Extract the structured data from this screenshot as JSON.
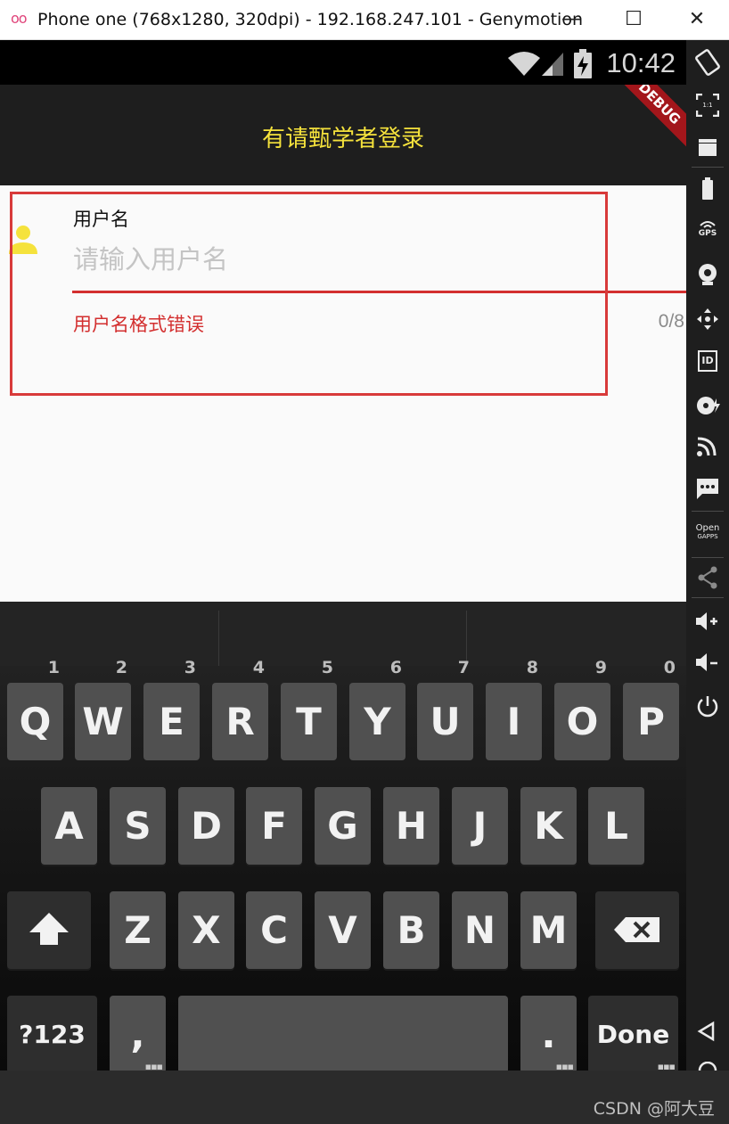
{
  "window": {
    "logo": "oo",
    "title": "Phone one (768x1280, 320dpi) - 192.168.247.101 - Genymotion",
    "minimize": "—",
    "maximize": "☐",
    "close": "✕"
  },
  "statusbar": {
    "time": "10:42"
  },
  "appbar": {
    "title": "有请甄学者登录",
    "banner": "DEBUG"
  },
  "form": {
    "label": "用户名",
    "placeholder": "请输入用户名",
    "error": "用户名格式错误",
    "counter": "0/8",
    "colors": {
      "error": "#d32f2f",
      "icon": "#f5e23c"
    }
  },
  "keyboard": {
    "row1": [
      {
        "key": "Q",
        "num": "1"
      },
      {
        "key": "W",
        "num": "2"
      },
      {
        "key": "E",
        "num": "3"
      },
      {
        "key": "R",
        "num": "4"
      },
      {
        "key": "T",
        "num": "5"
      },
      {
        "key": "Y",
        "num": "6"
      },
      {
        "key": "U",
        "num": "7"
      },
      {
        "key": "I",
        "num": "8"
      },
      {
        "key": "O",
        "num": "9"
      },
      {
        "key": "P",
        "num": "0"
      }
    ],
    "row2": [
      "A",
      "S",
      "D",
      "F",
      "G",
      "H",
      "J",
      "K",
      "L"
    ],
    "row3": [
      "Z",
      "X",
      "C",
      "V",
      "B",
      "N",
      "M"
    ],
    "symbols": "?123",
    "comma": ",",
    "period": ".",
    "done": "Done"
  },
  "sidebar": {
    "scale_label": "1:1",
    "gps_label": "GPS",
    "id_label": "ID",
    "open_gapps_line1": "Open",
    "open_gapps_line2": "GAPPS"
  },
  "watermark": "CSDN @阿大豆"
}
